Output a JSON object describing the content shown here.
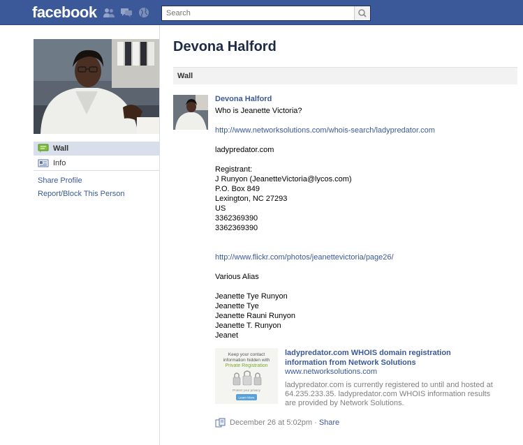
{
  "header": {
    "logo": "facebook",
    "search_placeholder": "Search"
  },
  "sidebar": {
    "nav": [
      {
        "label": "Wall",
        "icon": "wall-icon",
        "active": true
      },
      {
        "label": "Info",
        "icon": "info-icon",
        "active": false
      }
    ],
    "links": [
      "Share Profile",
      "Report/Block This Person"
    ]
  },
  "profile": {
    "name": "Devona Halford"
  },
  "wall": {
    "header": "Wall"
  },
  "post": {
    "author": "Devona Halford",
    "lines": [
      "Who is Jeanette Victoria?",
      "",
      "http://www.networksolutions.com/whois-search/ladypredator.com",
      "",
      "ladypredator.com",
      "",
      "Registrant:",
      "J Runyon (JeanetteVictoria@lycos.com)",
      "P.O. Box 849",
      "Lexington, NC 27293",
      "US",
      "3362369390",
      "3362369390",
      "",
      "",
      "http://www.flickr.com/photos/jeanettevictoria/page26/",
      "",
      "Various Alias",
      "",
      "Jeanette Tye Runyon",
      "Jeanette Tye",
      "Jeanette Rauni Runyon",
      "Jeanette T. Runyon",
      "Jeanet"
    ],
    "attachment": {
      "image_line1": "Keep your contact",
      "image_line2": "information hidden with",
      "image_line3": "Private Registration",
      "image_line4": "Protect your privacy",
      "image_button": "Learn More",
      "title": "ladypredator.com WHOIS domain registration information from Network Solutions",
      "domain": "www.networksolutions.com",
      "description": "ladypredator.com is currently registered to until and hosted at 64.235.233.35. ladypredator.com WHOIS information results are provided by Network Solutions."
    },
    "footer": {
      "timestamp": "December 26 at 5:02pm",
      "separator": "·",
      "share_label": "Share"
    }
  },
  "colors": {
    "brand_blue": "#3b5998",
    "nav_active_bg": "#d8dfea"
  }
}
